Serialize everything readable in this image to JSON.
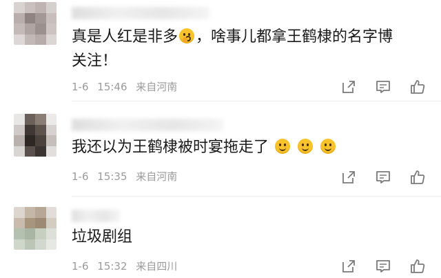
{
  "colors": {
    "text": "#1a1a1a",
    "meta": "#9a9a9a",
    "icon": "#7a7a7a"
  },
  "comments": [
    {
      "text_before_emoji": "真是人红是非多",
      "emoji": "shushing-face-emoji",
      "text_after_emoji": "，啥事儿都拿王鹤棣的名字博关注！",
      "date": "1-6",
      "time": "15:46",
      "location": "来自河南"
    },
    {
      "text_before_emoji": "我还以为王鹤棣被时宴拖走了",
      "emoji": "smiling-face-emoji",
      "emoji_count": 3,
      "text_after_emoji": "",
      "date": "1-6",
      "time": "15:35",
      "location": "来自河南"
    },
    {
      "text_before_emoji": "垃圾剧组",
      "text_after_emoji": "",
      "date": "1-6",
      "time": "15:32",
      "location": "来自四川"
    }
  ],
  "action_icons": [
    "share-icon",
    "comment-icon",
    "like-icon"
  ]
}
